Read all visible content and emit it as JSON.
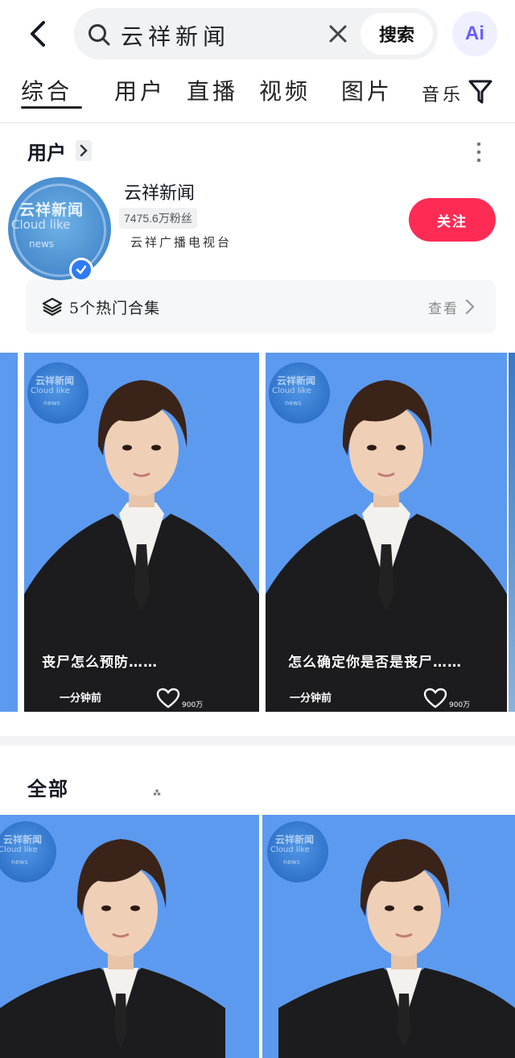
{
  "search": {
    "query": "云祥新闻",
    "button_label": "搜索",
    "ai_label": "Ai"
  },
  "tabs": [
    {
      "label": "综合",
      "active": true
    },
    {
      "label": "用户",
      "active": false
    },
    {
      "label": "直播",
      "active": false
    },
    {
      "label": "视频",
      "active": false
    },
    {
      "label": "图片",
      "active": false
    },
    {
      "label": "音乐",
      "active": false
    }
  ],
  "user_section": {
    "title": "用户",
    "user": {
      "name": "云祥新闻",
      "fans": "7475.6万粉丝",
      "description": "云祥广播电视台",
      "verified": true,
      "avatar_text": "云祥新闻",
      "avatar_sub": "Cloud like",
      "avatar_sub2": "news"
    },
    "follow_label": "关注",
    "collection": {
      "label": "5个热门合集",
      "view_label": "查看"
    }
  },
  "videos": [
    {
      "caption": "丧尸怎么预防……",
      "time": "一分钟前",
      "likes": "900万"
    },
    {
      "caption": "怎么确定你是否是丧尸……",
      "time": "一分钟前",
      "likes": "900万"
    }
  ],
  "card_logo": {
    "t1": "云祥新闻",
    "t2": "Cloud like",
    "t3": "news"
  },
  "all_section": {
    "title": "全部",
    "mark": "⁂"
  },
  "colors": {
    "accent": "#fe2c55",
    "card_bg": "#5c9af0",
    "verified": "#2f7bf5"
  }
}
